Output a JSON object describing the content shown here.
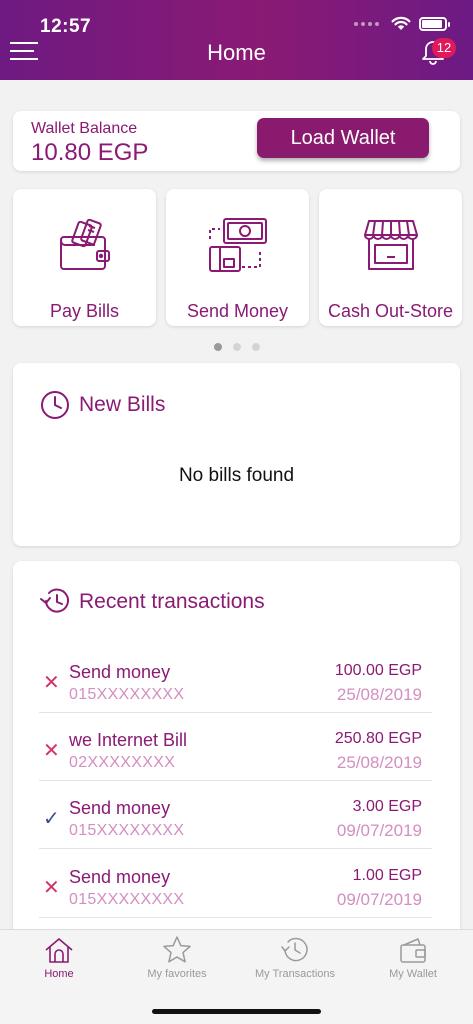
{
  "status": {
    "time": "12:57"
  },
  "header": {
    "title": "Home",
    "notification_count": "12"
  },
  "wallet": {
    "label": "Wallet Balance",
    "value": "10.80 EGP",
    "load_label": "Load Wallet"
  },
  "services": [
    {
      "label": "Pay Bills",
      "icon": "wallet-icon"
    },
    {
      "label": "Send Money",
      "icon": "send-money-icon"
    },
    {
      "label": "Cash Out-Store",
      "icon": "store-icon"
    }
  ],
  "pager": {
    "pages": 3,
    "active": 0
  },
  "bills": {
    "title": "New Bills",
    "empty": "No bills found"
  },
  "transactions": {
    "title": "Recent transactions",
    "items": [
      {
        "status": "failed",
        "name": "Send money",
        "ref": "015XXXXXXXX",
        "amount": "100.00 EGP",
        "date": "25/08/2019"
      },
      {
        "status": "failed",
        "name": "we Internet Bill",
        "ref": "02XXXXXXXX",
        "amount": "250.80 EGP",
        "date": "25/08/2019"
      },
      {
        "status": "success",
        "name": "Send money",
        "ref": "015XXXXXXXX",
        "amount": "3.00 EGP",
        "date": "09/07/2019"
      },
      {
        "status": "failed",
        "name": "Send money",
        "ref": "015XXXXXXXX",
        "amount": "1.00 EGP",
        "date": "09/07/2019"
      }
    ]
  },
  "tabs": [
    {
      "label": "Home",
      "icon": "home-icon",
      "active": true
    },
    {
      "label": "My favorites",
      "icon": "star-icon",
      "active": false
    },
    {
      "label": "My Transactions",
      "icon": "history-icon",
      "active": false
    },
    {
      "label": "My Wallet",
      "icon": "wallet-tab-icon",
      "active": false
    }
  ],
  "colors": {
    "brand": "#8a1a74",
    "header_start": "#6e1a82",
    "badge": "#e0195a",
    "failed": "#d4326b",
    "success": "#3d4f8a"
  }
}
